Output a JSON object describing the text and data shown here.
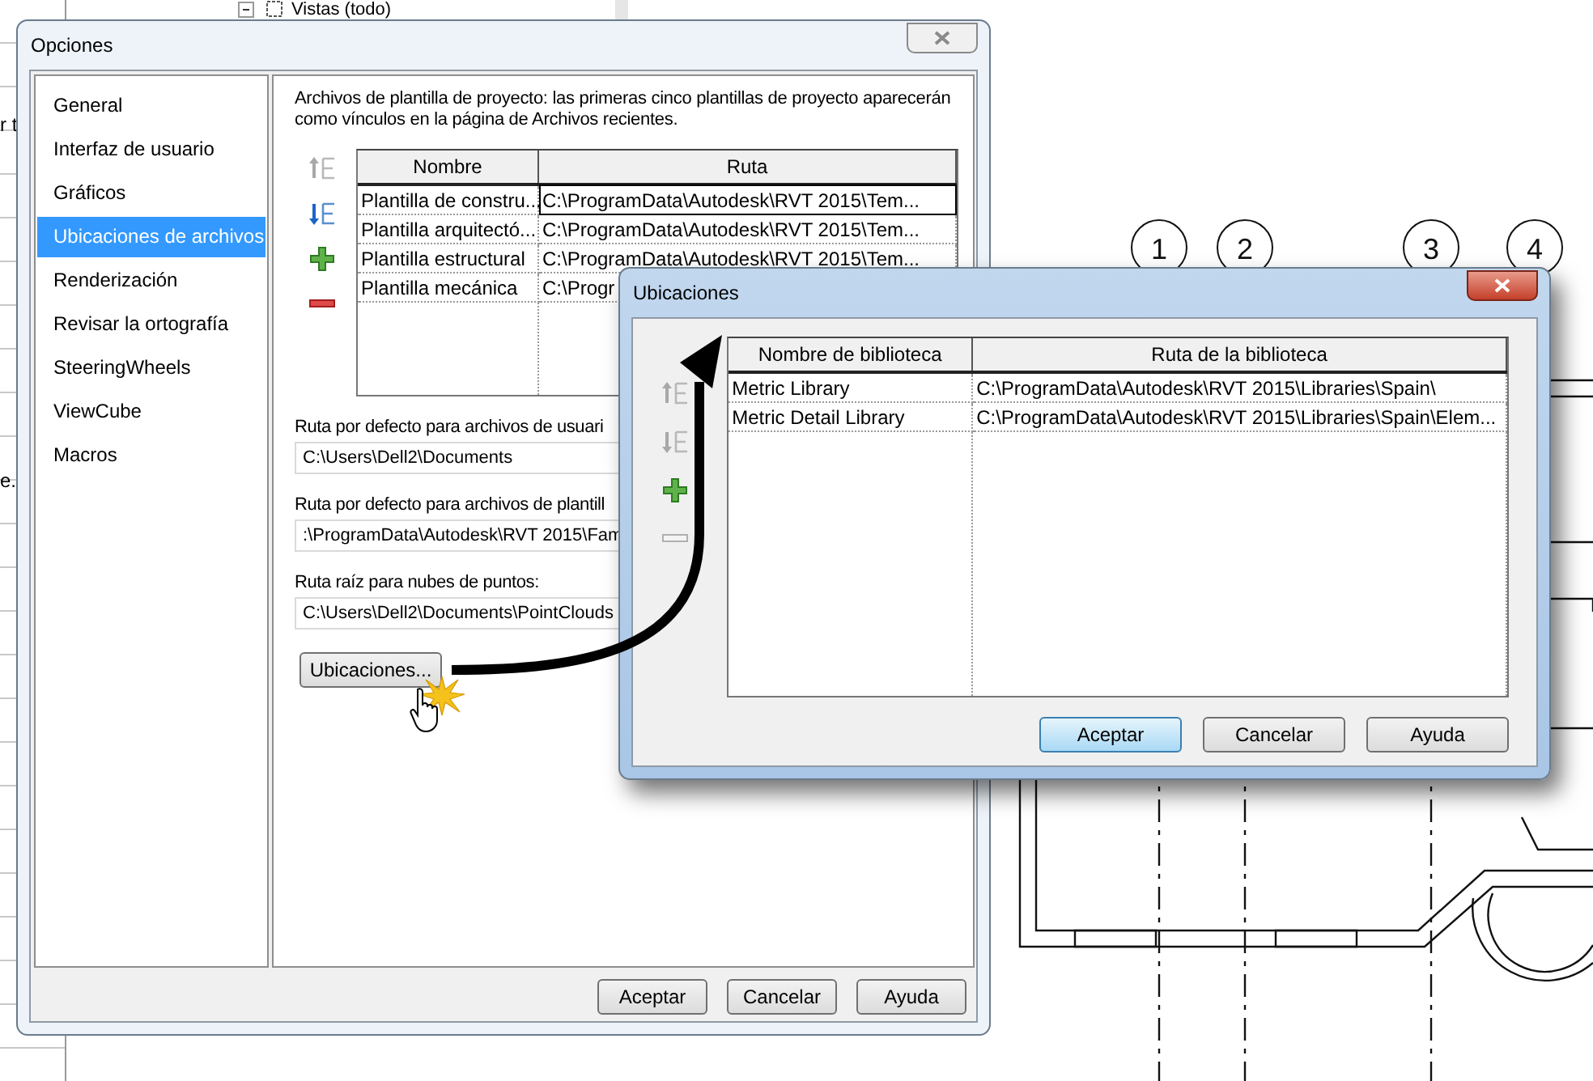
{
  "background": {
    "tree_item": "Vistas (todo)",
    "edge_texts": [
      "r t",
      "e."
    ],
    "grid_labels": [
      "1",
      "2",
      "3",
      "4"
    ]
  },
  "options_dialog": {
    "title": "Opciones",
    "active": false,
    "sidebar": {
      "items": [
        {
          "label": "General",
          "selected": false
        },
        {
          "label": "Interfaz de usuario",
          "selected": false
        },
        {
          "label": "Gráficos",
          "selected": false
        },
        {
          "label": "Ubicaciones de archivos",
          "selected": true
        },
        {
          "label": "Renderización",
          "selected": false
        },
        {
          "label": "Revisar la ortografía",
          "selected": false
        },
        {
          "label": "SteeringWheels",
          "selected": false
        },
        {
          "label": "ViewCube",
          "selected": false
        },
        {
          "label": "Macros",
          "selected": false
        }
      ]
    },
    "description": "Archivos de plantilla de proyecto: las primeras cinco plantillas de proyecto aparecerán como vínculos en la página de Archivos recientes.",
    "tools": [
      {
        "kind": "move_up",
        "disabled": true
      },
      {
        "kind": "move_down",
        "disabled": false
      },
      {
        "kind": "add",
        "disabled": false
      },
      {
        "kind": "remove",
        "disabled": false
      }
    ],
    "table": {
      "columns": [
        "Nombre",
        "Ruta"
      ],
      "rows": [
        {
          "name": "Plantilla de constru...",
          "path": "C:\\ProgramData\\Autodesk\\RVT 2015\\Tem...",
          "focused": true
        },
        {
          "name": "Plantilla arquitectó...",
          "path": "C:\\ProgramData\\Autodesk\\RVT 2015\\Tem...",
          "focused": false
        },
        {
          "name": "Plantilla estructural",
          "path": "C:\\ProgramData\\Autodesk\\RVT 2015\\Tem...",
          "focused": false
        },
        {
          "name": "Plantilla mecánica",
          "path": "C:\\Progr",
          "focused": false
        }
      ]
    },
    "paths": [
      {
        "label": "Ruta por defecto para archivos de usuari",
        "value": "C:\\Users\\Dell2\\Documents"
      },
      {
        "label": "Ruta por defecto para archivos de plantill",
        "value": ":\\ProgramData\\Autodesk\\RVT 2015\\Fam"
      },
      {
        "label": "Ruta raíz para nubes de puntos:",
        "value": "C:\\Users\\Dell2\\Documents\\PointClouds"
      }
    ],
    "locations_button": "Ubicaciones...",
    "buttons": [
      {
        "label": "Aceptar",
        "default": false
      },
      {
        "label": "Cancelar",
        "default": false
      },
      {
        "label": "Ayuda",
        "default": false
      }
    ]
  },
  "locations_dialog": {
    "title": "Ubicaciones",
    "active": true,
    "tools": [
      {
        "kind": "move_up",
        "disabled": true
      },
      {
        "kind": "move_down",
        "disabled": true
      },
      {
        "kind": "add",
        "disabled": false
      },
      {
        "kind": "remove",
        "disabled": true
      }
    ],
    "table": {
      "columns": [
        "Nombre de biblioteca",
        "Ruta de la biblioteca"
      ],
      "rows": [
        {
          "name": "Metric Library",
          "path": "C:\\ProgramData\\Autodesk\\RVT 2015\\Libraries\\Spain\\",
          "focused": false
        },
        {
          "name": "Metric Detail Library",
          "path": "C:\\ProgramData\\Autodesk\\RVT 2015\\Libraries\\Spain\\Elem...",
          "focused": false
        }
      ]
    },
    "buttons": [
      {
        "label": "Aceptar",
        "default": true
      },
      {
        "label": "Cancelar",
        "default": false
      },
      {
        "label": "Ayuda",
        "default": false
      }
    ]
  }
}
